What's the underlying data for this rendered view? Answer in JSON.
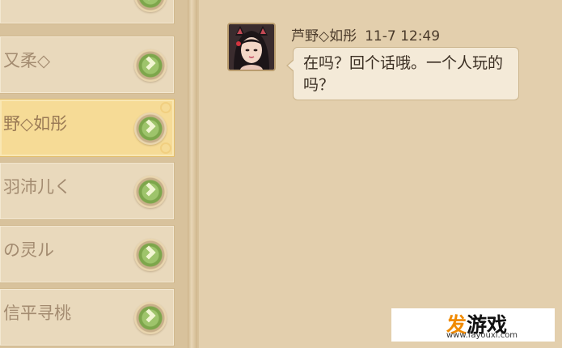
{
  "contacts": [
    {
      "name": ""
    },
    {
      "name": "又柔◇"
    },
    {
      "name": "野◇如彤",
      "selected": true
    },
    {
      "name": "羽沛儿く"
    },
    {
      "name": "の灵ル"
    },
    {
      "name": "信平寻桃"
    }
  ],
  "chat": {
    "sender": "芦野◇如彤",
    "time": "11-7 12:49",
    "message": "在吗？回个话哦。一个人玩的吗？"
  },
  "watermark": {
    "logo_accent": "发",
    "logo_rest": "游戏",
    "url": "www.fayouxi.com"
  },
  "colors": {
    "selected_row": "#f6db96",
    "go_button": "#9ec46b",
    "panel_bg": "#e3cfad"
  }
}
